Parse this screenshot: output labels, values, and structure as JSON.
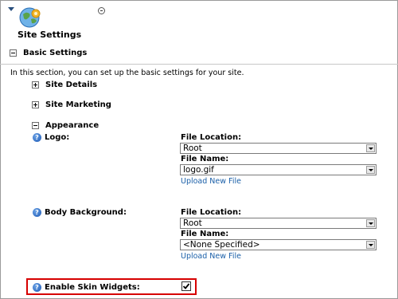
{
  "header": {
    "title": "Site Settings"
  },
  "basic": {
    "title": "Basic Settings",
    "intro": "In this section, you can set up the basic settings for your site."
  },
  "sections": {
    "site_details": "Site Details",
    "site_marketing": "Site Marketing",
    "appearance": "Appearance"
  },
  "logo": {
    "label": "Logo:",
    "file_location_label": "File Location:",
    "file_location_value": "Root",
    "file_name_label": "File Name:",
    "file_name_value": "logo.gif",
    "upload_link": "Upload New File"
  },
  "body_background": {
    "label": "Body Background:",
    "file_location_label": "File Location:",
    "file_location_value": "Root",
    "file_name_label": "File Name:",
    "file_name_value": "<None Specified>",
    "upload_link": "Upload New File"
  },
  "skin_widgets": {
    "label": "Enable Skin Widgets:",
    "checked": true
  },
  "help_glyph": "?",
  "colors": {
    "link": "#1a5fa8",
    "highlight": "#d60000",
    "help": "#1f5ab4"
  }
}
